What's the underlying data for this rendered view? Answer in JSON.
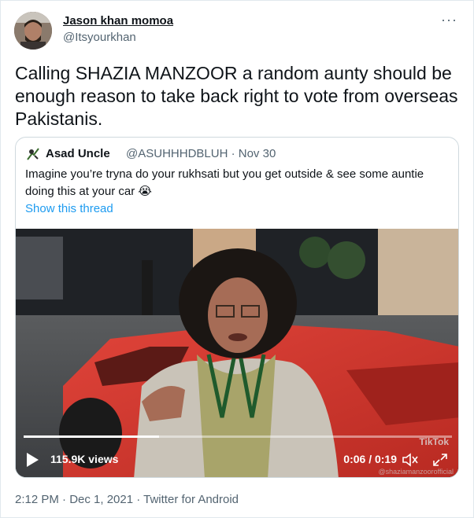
{
  "author": {
    "name": "Jason khan momoa",
    "handle": "@Itsyourkhan"
  },
  "more_icon": "···",
  "tweet_text": "Calling SHAZIA MANZOOR a random aunty should be enough reason to take back right to vote from overseas Pakistanis.",
  "quoted": {
    "name": "Asad Uncle",
    "handle": "@ASUHHHDBLUH",
    "date": "· Nov 30",
    "text": "Imagine you’re tryna do your rukhsati but you get outside & see some auntie doing this at your car 😭",
    "show_thread": "Show this thread",
    "video": {
      "views": "115.9K views",
      "time": "0:06 / 0:19",
      "progress_fraction": 0.316,
      "watermark": "TikTok",
      "watermark_handle": "@shaziamanzoorofficial"
    }
  },
  "footer": "2:12 PM · Dec 1, 2021 · Twitter for Android",
  "colors": {
    "link": "#1d9bf0",
    "secondary": "#536471",
    "car": "#d8352b"
  }
}
